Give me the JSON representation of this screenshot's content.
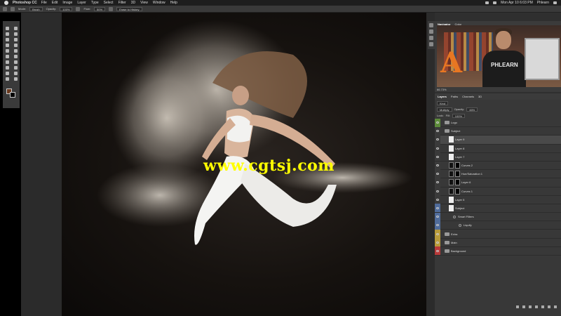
{
  "menubar": {
    "app_name": "Photoshop CC",
    "items": [
      "File",
      "Edit",
      "Image",
      "Layer",
      "Type",
      "Select",
      "Filter",
      "3D",
      "View",
      "Window",
      "Help"
    ],
    "clock": "Mon Apr 10  6:03 PM",
    "user": "Phlearn"
  },
  "options_bar": {
    "mode_label": "Mode:",
    "mode_value": "Brush",
    "opacity_label": "Opacity:",
    "opacity_value": "100%",
    "flow_label": "Flow:",
    "flow_value": "50%",
    "erase_history": "Erase to History"
  },
  "canvas": {
    "watermark": "www.cgtsj.com"
  },
  "navigator": {
    "tabs": [
      "Navigator",
      "Color"
    ],
    "webcam_shirt_text": "PHLEARN",
    "webcam_sign_letter": "A",
    "zoom": "66.73%"
  },
  "layers_panel": {
    "tabs": [
      "Layers",
      "Paths",
      "Channels",
      "3D"
    ],
    "kind_label": "Kind",
    "blend_mode": "Multiply",
    "opacity_label": "Opacity:",
    "opacity_value": "46%",
    "lock_label": "Lock:",
    "fill_label": "Fill:",
    "fill_value": "100%",
    "layers": [
      {
        "name": "Logo",
        "type": "folder",
        "color": "#5c8a3a"
      },
      {
        "name": "Subject",
        "type": "folder",
        "color": "#3a3a3a"
      },
      {
        "name": "Layer 9",
        "type": "layer",
        "color": "#3a3a3a",
        "selected": true
      },
      {
        "name": "Layer 8",
        "type": "layer",
        "color": "#3a3a3a"
      },
      {
        "name": "Layer 7",
        "type": "layer",
        "color": "#3a3a3a"
      },
      {
        "name": "Curves 2",
        "type": "adjust",
        "color": "#3a3a3a"
      },
      {
        "name": "Hue/Saturation 1",
        "type": "adjust",
        "color": "#3a3a3a"
      },
      {
        "name": "Layer 6",
        "type": "adjust",
        "color": "#3a3a3a"
      },
      {
        "name": "Curves 1",
        "type": "adjust",
        "color": "#3a3a3a"
      },
      {
        "name": "Layer 5",
        "type": "layer",
        "color": "#3a3a3a"
      },
      {
        "name": "Subject",
        "type": "smart",
        "color": "#4f6b9a"
      },
      {
        "name": "Smart Filters",
        "type": "sub",
        "color": "#4f6b9a"
      },
      {
        "name": "Liquify",
        "type": "sub2",
        "color": "#4f6b9a"
      },
      {
        "name": "Extra",
        "type": "folder",
        "color": "#b89a3a"
      },
      {
        "name": "Main",
        "type": "folder",
        "color": "#b89a3a"
      },
      {
        "name": "Background",
        "type": "folder",
        "color": "#b83a3a"
      }
    ]
  }
}
